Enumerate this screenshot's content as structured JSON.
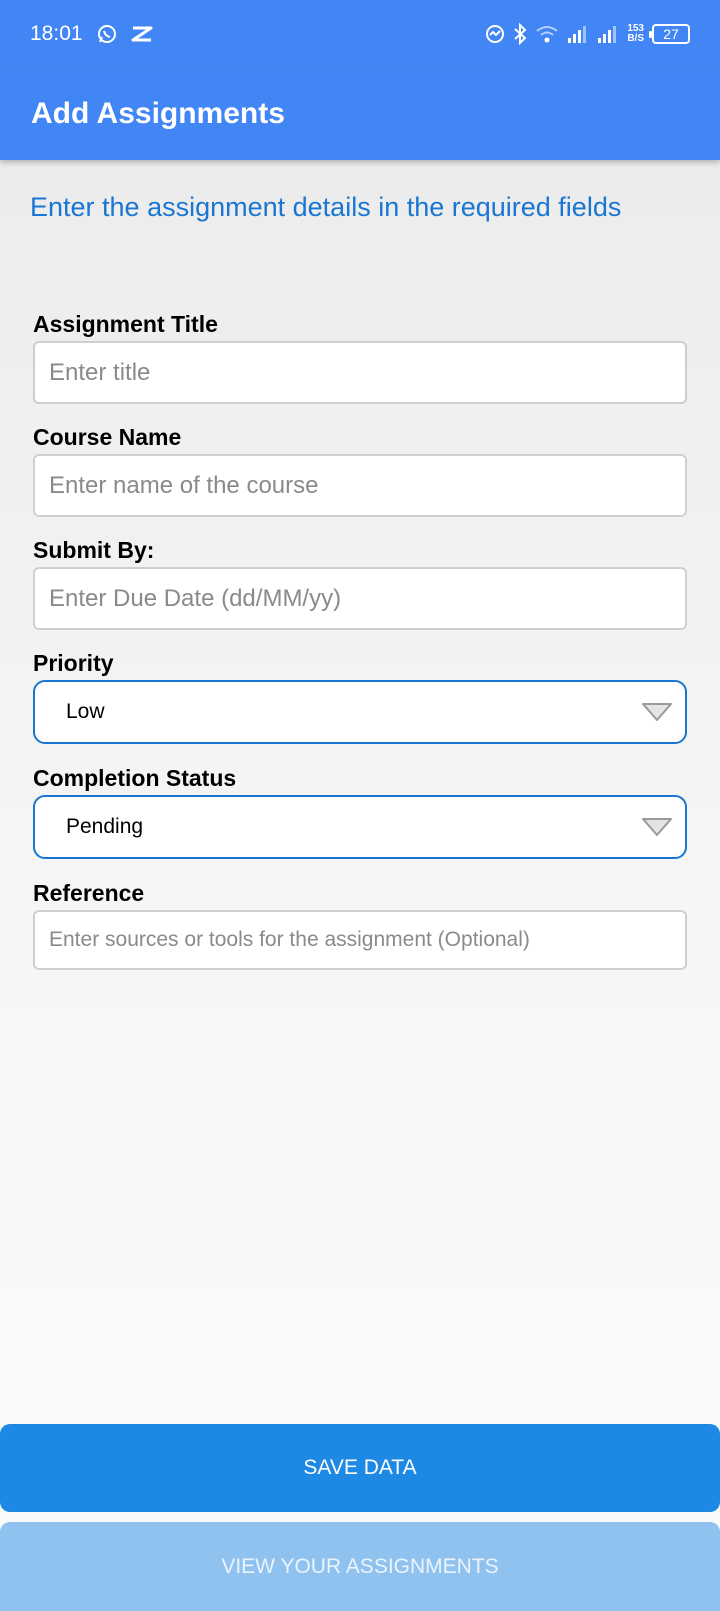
{
  "status_bar": {
    "time": "18:01",
    "net_speed_value": "153",
    "net_speed_unit": "B/S",
    "battery_level": "27",
    "icons": [
      "whatsapp-icon",
      "capcut-icon",
      "messenger-icon",
      "bluetooth-icon",
      "wifi-icon",
      "signal-icon",
      "signal-icon-2"
    ]
  },
  "appbar": {
    "title": "Add Assignments"
  },
  "instruction": "Enter the assignment details in the required fields",
  "form": {
    "title_label": "Assignment Title",
    "title_placeholder": "Enter title",
    "course_label": "Course Name",
    "course_placeholder": "Enter name of the course",
    "due_label": "Submit By:",
    "due_placeholder": "Enter Due Date (dd/MM/yy)",
    "priority_label": "Priority",
    "priority_value": "Low",
    "status_label": "Completion Status",
    "status_value": "Pending",
    "reference_label": "Reference",
    "reference_placeholder": "Enter sources or tools for the assignment (Optional)"
  },
  "buttons": {
    "save": "SAVE DATA",
    "view": "VIEW YOUR ASSIGNMENTS"
  },
  "colors": {
    "app_bar": "#4285f4",
    "accent": "#1976d2",
    "save_button": "#1e88e5",
    "view_button": "#90c2f0"
  }
}
